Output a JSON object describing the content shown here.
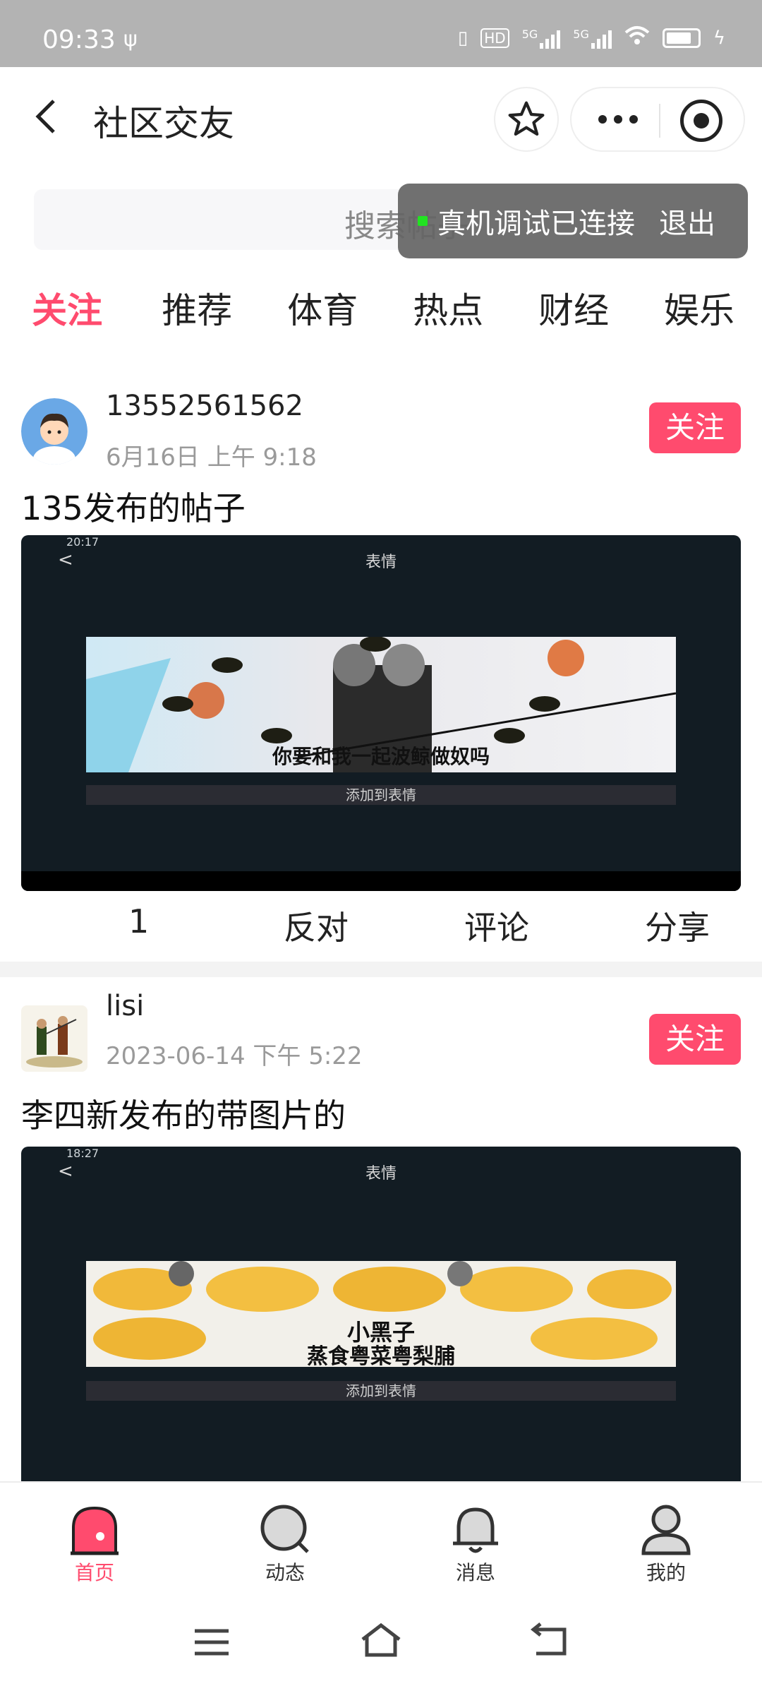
{
  "status_bar": {
    "time": "09:33",
    "network": "5G",
    "hd": "HD"
  },
  "navbar": {
    "title": "社区交友"
  },
  "search": {
    "placeholder": "搜索帖子"
  },
  "debug_toast": {
    "text": "真机调试已连接",
    "exit": "退出"
  },
  "tabs": [
    "关注",
    "推荐",
    "体育",
    "热点",
    "财经",
    "娱乐"
  ],
  "posts": [
    {
      "user": "13552561562",
      "time": "6月16日 上午 9:18",
      "follow": "关注",
      "title": "135发布的帖子",
      "image": {
        "status_time": "20:17",
        "screen_title": "表情",
        "caption": "你要和我一起波鲸做奴吗",
        "add_label": "添加到表情"
      },
      "actions": {
        "count": "1",
        "oppose": "反对",
        "comment": "评论",
        "share": "分享"
      }
    },
    {
      "user": "lisi",
      "time": "2023-06-14 下午 5:22",
      "follow": "关注",
      "title": "李四新发布的带图片的",
      "image": {
        "status_time": "18:27",
        "screen_title": "表情",
        "caption_top": "小黑子",
        "caption_bottom": "蒸食粤菜粤梨脯",
        "add_label": "添加到表情"
      }
    }
  ],
  "tabbar": [
    {
      "label": "首页",
      "icon": "home-icon",
      "active": true
    },
    {
      "label": "动态",
      "icon": "search-icon",
      "active": false
    },
    {
      "label": "消息",
      "icon": "bell-icon",
      "active": false
    },
    {
      "label": "我的",
      "icon": "user-icon",
      "active": false
    }
  ],
  "colors": {
    "accent": "#ff4b6e",
    "statusbar": "#b3b3b3",
    "image_bg": "#121c23"
  }
}
